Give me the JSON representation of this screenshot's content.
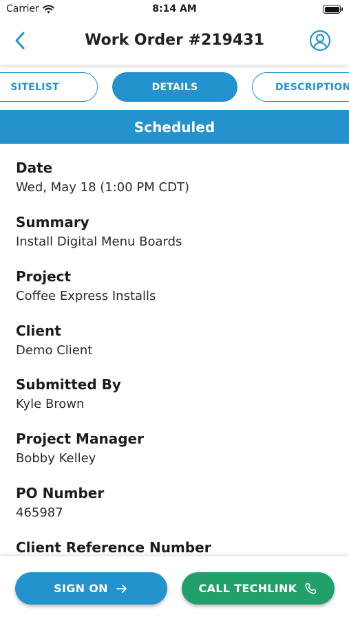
{
  "status_bar": {
    "carrier": "Carrier",
    "time": "8:14 AM",
    "battery_level": 1.0
  },
  "nav": {
    "title": "Work Order #219431",
    "back_icon": "chevron-left-icon",
    "profile_icon": "user-circle-icon"
  },
  "tabs": [
    {
      "label": "SITELIST",
      "active": false
    },
    {
      "label": "DETAILS",
      "active": true
    },
    {
      "label": "DESCRIPTION",
      "active": false
    }
  ],
  "status": "Scheduled",
  "fields": [
    {
      "label": "Date",
      "value": "Wed, May 18 (1:00 PM CDT)"
    },
    {
      "label": "Summary",
      "value": "Install Digital Menu Boards"
    },
    {
      "label": "Project",
      "value": "Coffee Express Installs"
    },
    {
      "label": "Client",
      "value": "Demo Client"
    },
    {
      "label": "Submitted By",
      "value": "Kyle Brown"
    },
    {
      "label": "Project Manager",
      "value": "Bobby Kelley"
    },
    {
      "label": "PO Number",
      "value": "465987"
    },
    {
      "label": "Client Reference Number",
      "value": ""
    }
  ],
  "actions": {
    "sign_on": "SIGN ON",
    "call_techlink": "CALL TECHLINK"
  },
  "colors": {
    "primary": "#2492cc",
    "success": "#21a06a",
    "text": "#1b1b1b"
  }
}
